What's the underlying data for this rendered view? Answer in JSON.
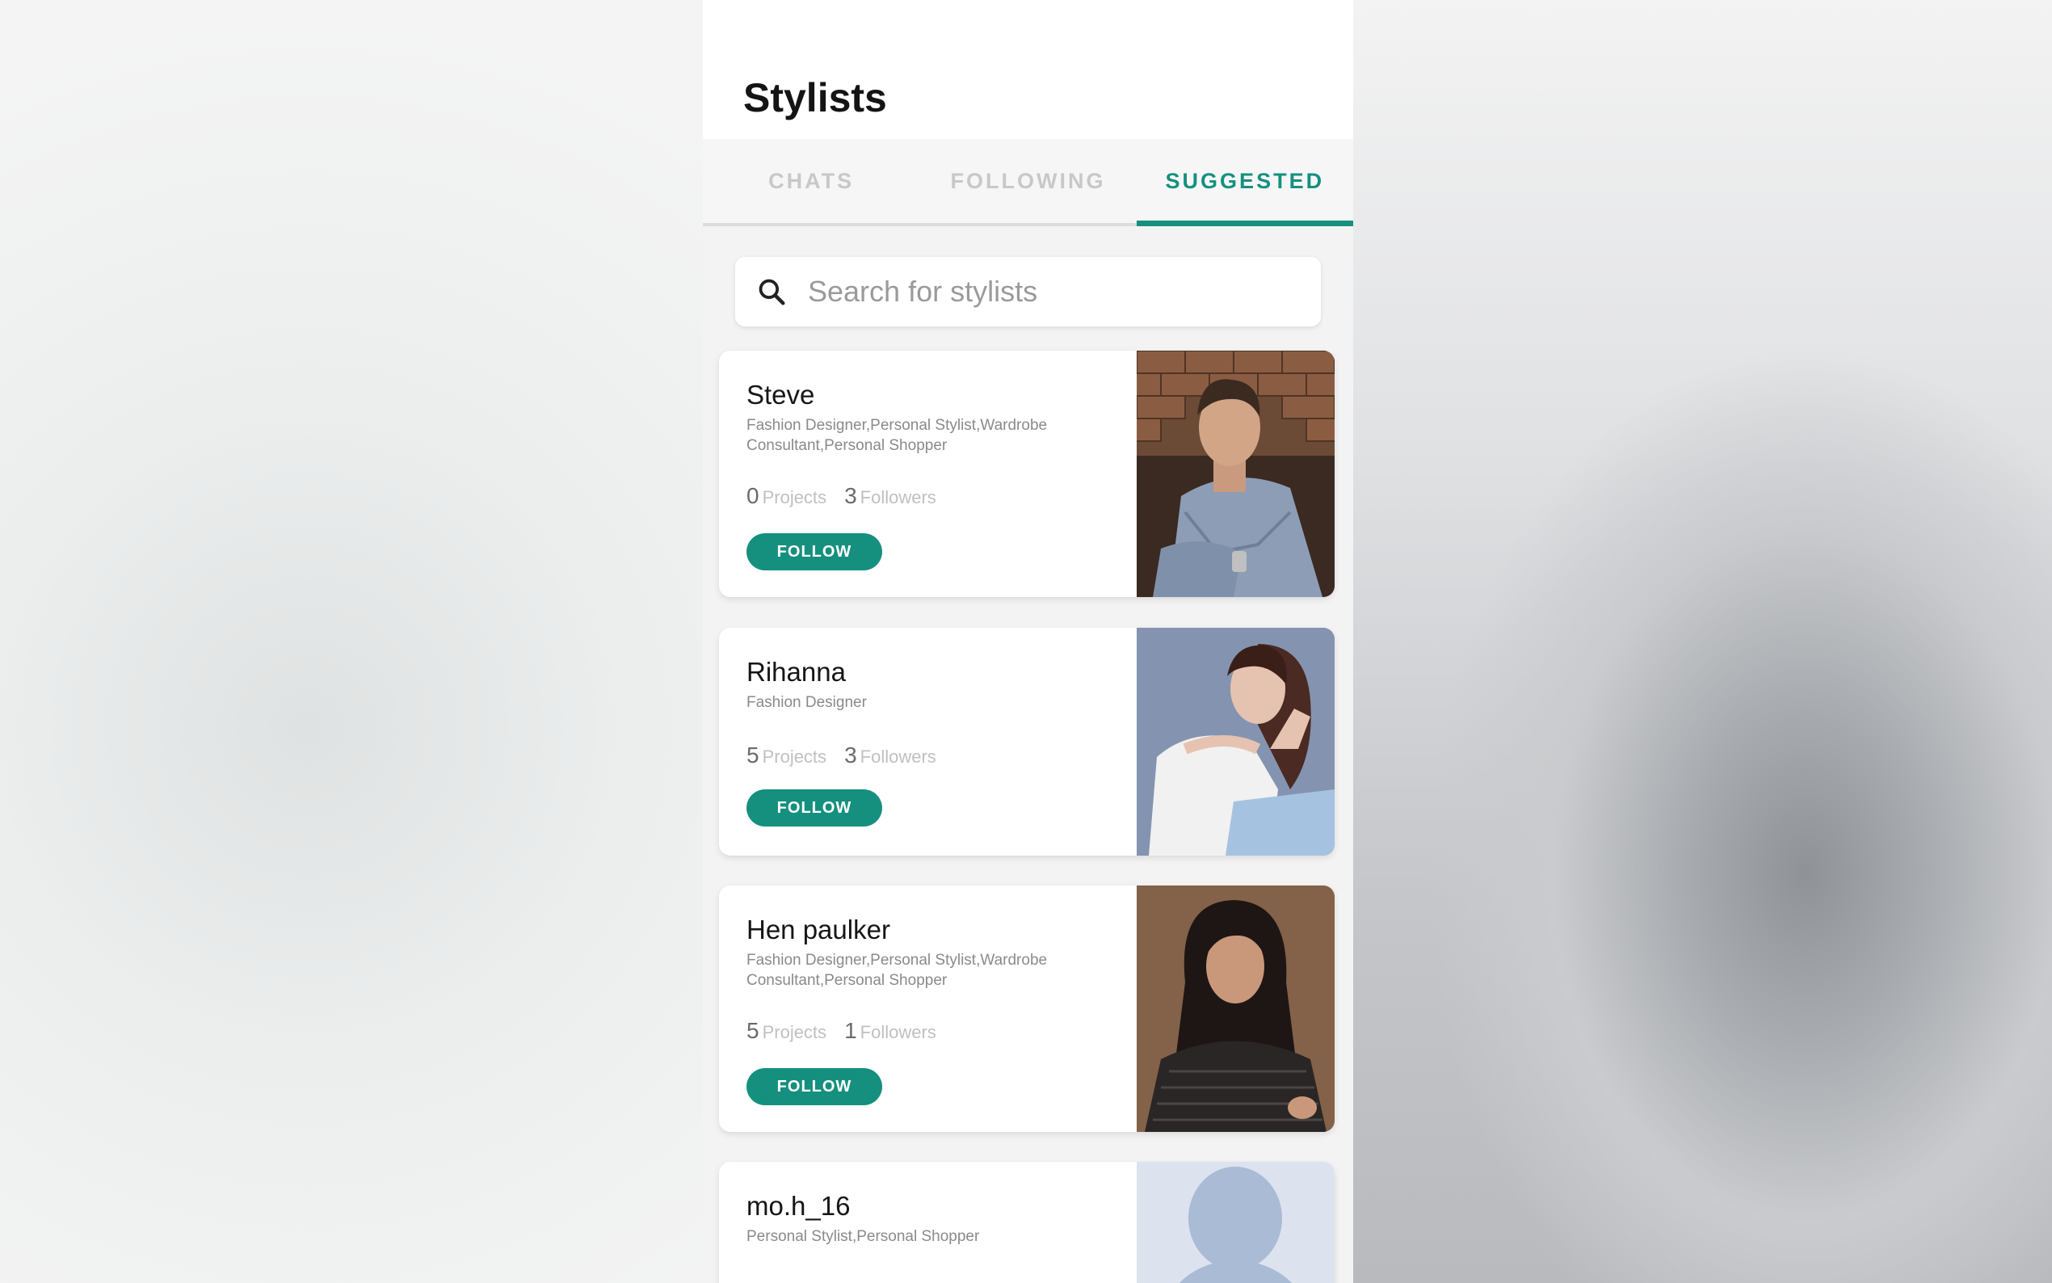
{
  "header": {
    "title": "Stylists"
  },
  "tabs": [
    {
      "label": "CHATS",
      "active": false
    },
    {
      "label": "FOLLOWING",
      "active": false
    },
    {
      "label": "SUGGESTED",
      "active": true
    }
  ],
  "search": {
    "placeholder": "Search for stylists",
    "icon": "search-icon"
  },
  "colors": {
    "accent": "#15907e"
  },
  "stylists": [
    {
      "name": "Steve",
      "tags": "Fashion Designer,Personal Stylist,Wardrobe Consultant,Personal Shopper",
      "projects": "0",
      "projects_label": "Projects",
      "followers": "3",
      "followers_label": "Followers",
      "follow_label": "FOLLOW"
    },
    {
      "name": "Rihanna",
      "tags": "Fashion Designer",
      "projects": "5",
      "projects_label": "Projects",
      "followers": "3",
      "followers_label": "Followers",
      "follow_label": "FOLLOW"
    },
    {
      "name": "Hen paulker",
      "tags": "Fashion Designer,Personal Stylist,Wardrobe Consultant,Personal Shopper",
      "projects": "5",
      "projects_label": "Projects",
      "followers": "1",
      "followers_label": "Followers",
      "follow_label": "FOLLOW"
    },
    {
      "name": "mo.h_16",
      "tags": "Personal Stylist,Personal Shopper",
      "projects": "",
      "followers": ""
    }
  ]
}
